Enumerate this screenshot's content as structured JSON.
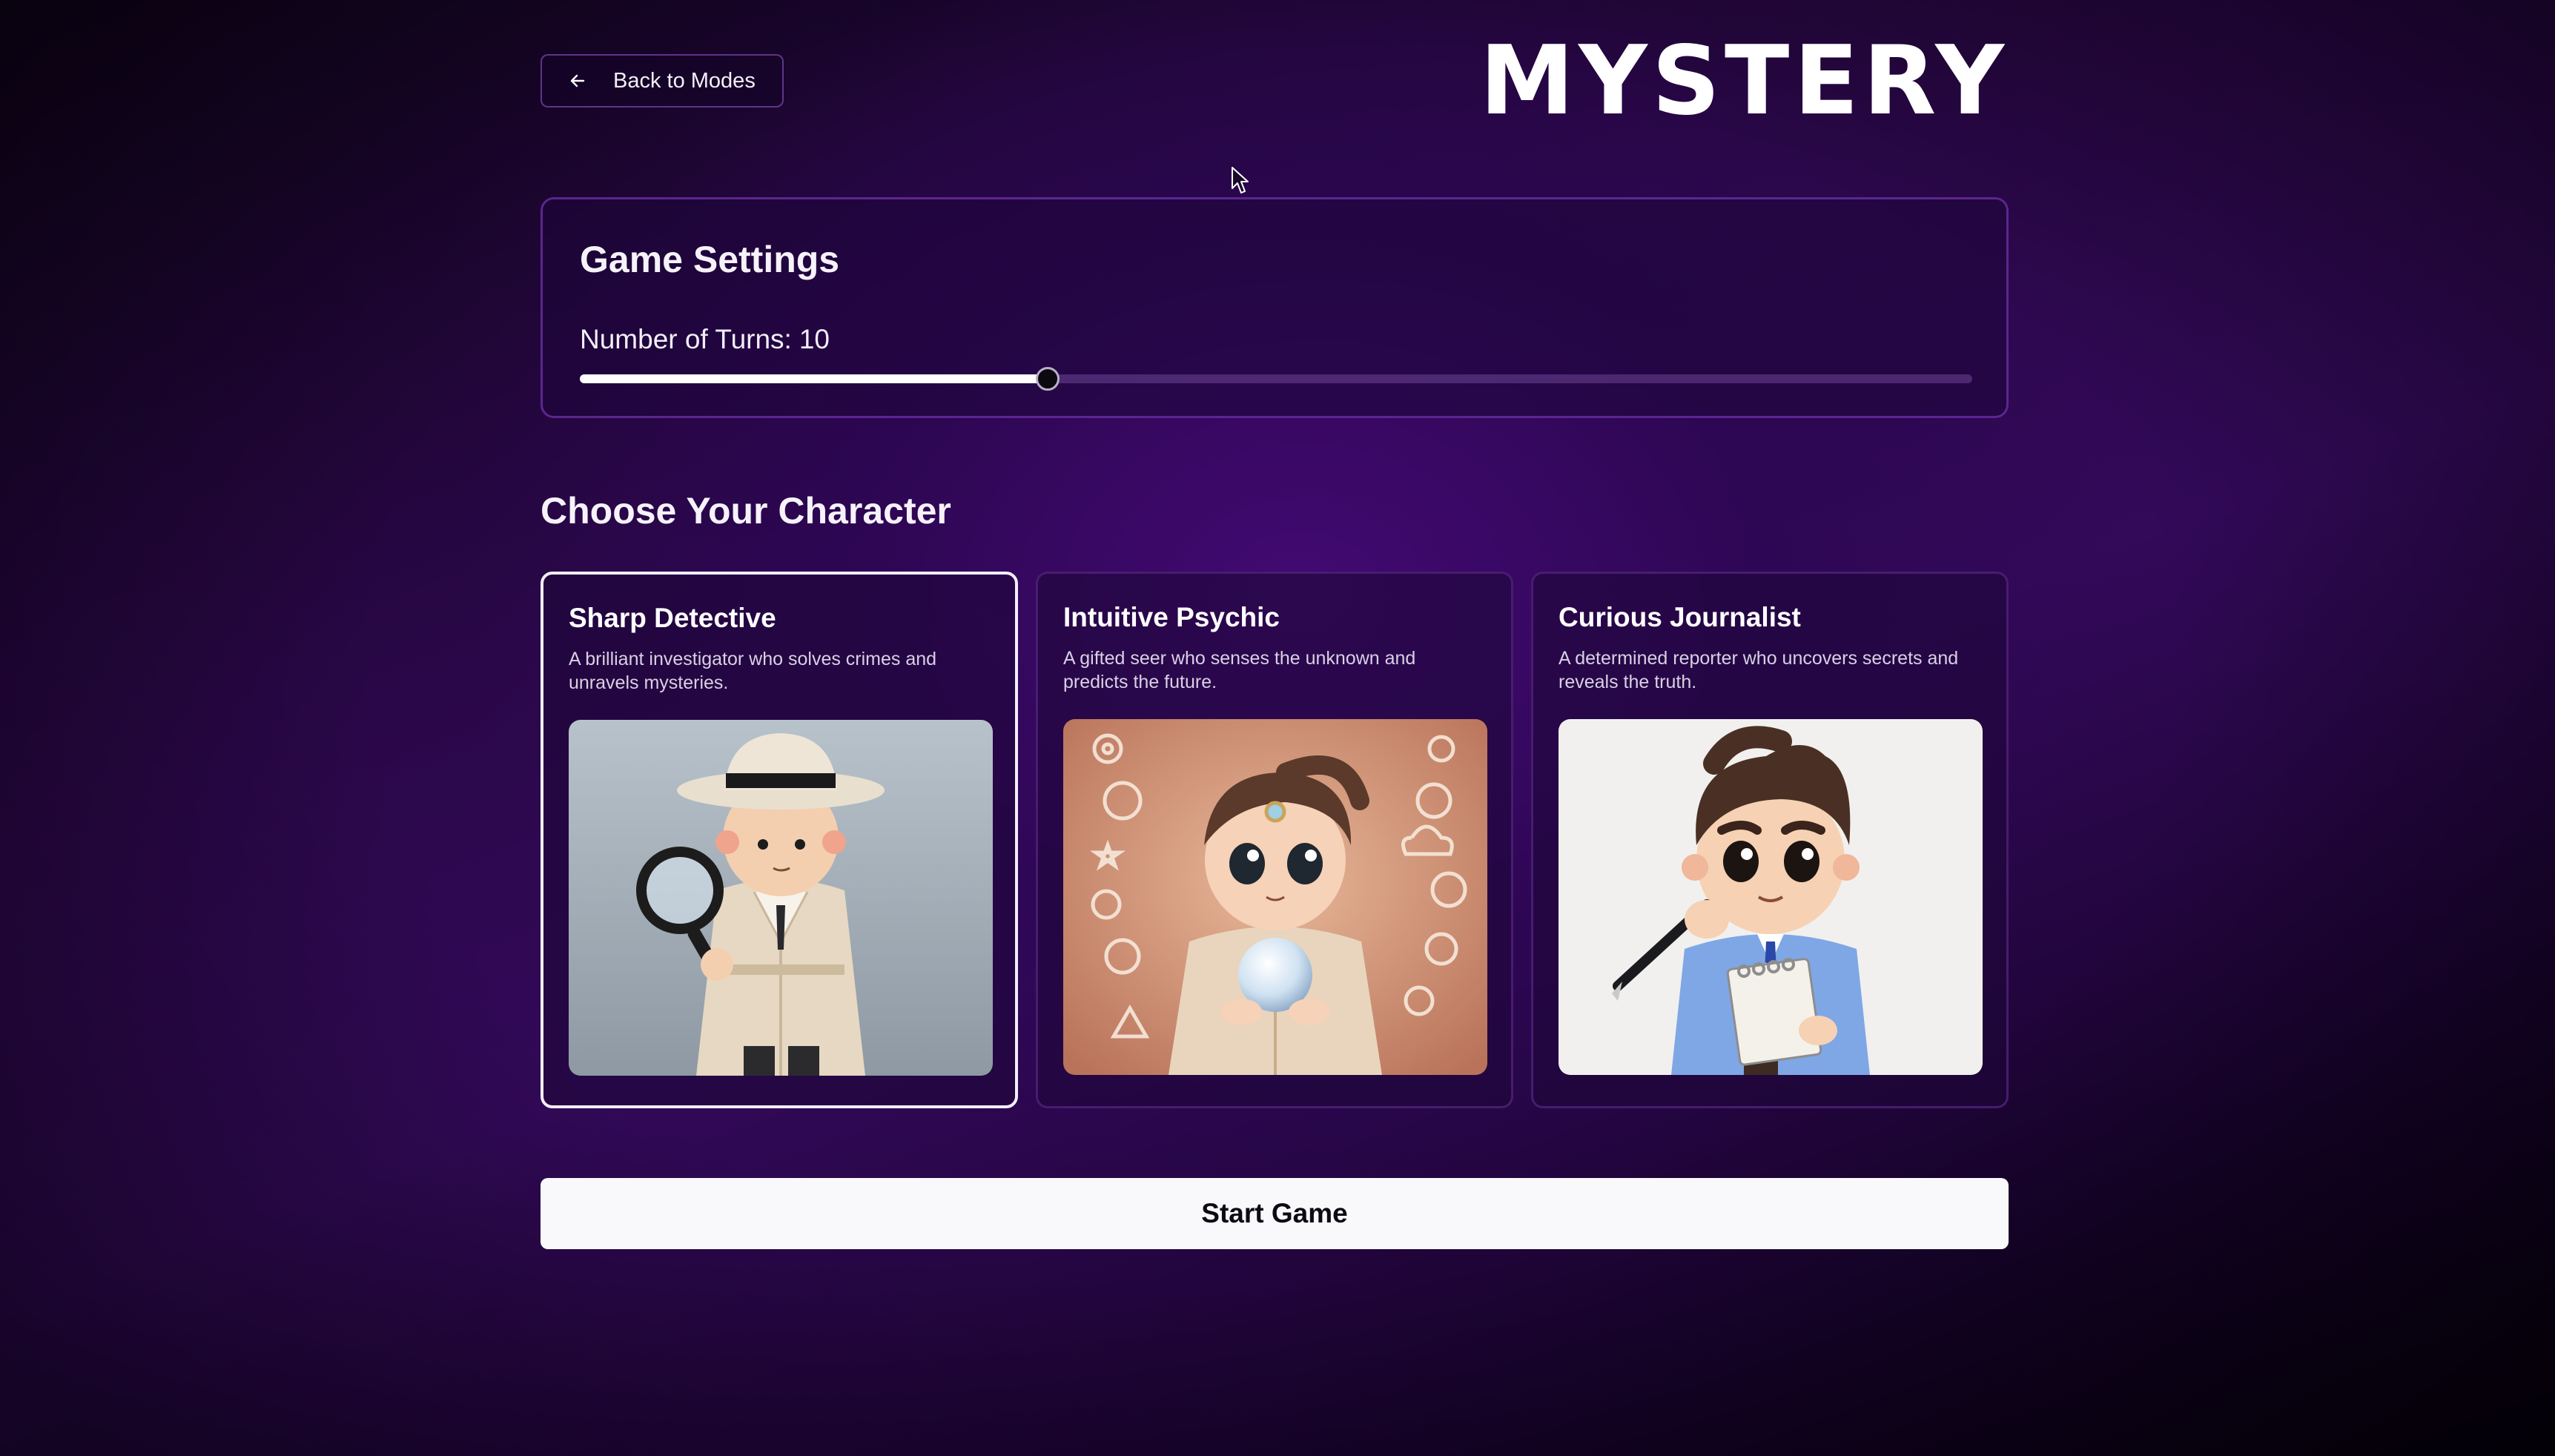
{
  "header": {
    "back_label": "Back to Modes",
    "brand": "MYSTERY"
  },
  "settings": {
    "title": "Game Settings",
    "turns_label": "Number of Turns:",
    "turns_value": "10",
    "slider_fraction": 0.336
  },
  "characters": {
    "title": "Choose Your Character",
    "selected": "Sharp Detective",
    "items": [
      {
        "name": "Sharp Detective",
        "description": "A brilliant investigator who solves crimes and unravels mysteries.",
        "icon": "detective-icon"
      },
      {
        "name": "Intuitive Psychic",
        "description": "A gifted seer who senses the unknown and predicts the future.",
        "icon": "psychic-icon"
      },
      {
        "name": "Curious Journalist",
        "description": "A determined reporter who uncovers secrets and reveals the truth.",
        "icon": "journalist-icon"
      }
    ]
  },
  "actions": {
    "start_label": "Start Game"
  },
  "colors": {
    "accent": "#3a0a66",
    "border": "#5f2896",
    "button_bg": "#f9f8fb"
  }
}
